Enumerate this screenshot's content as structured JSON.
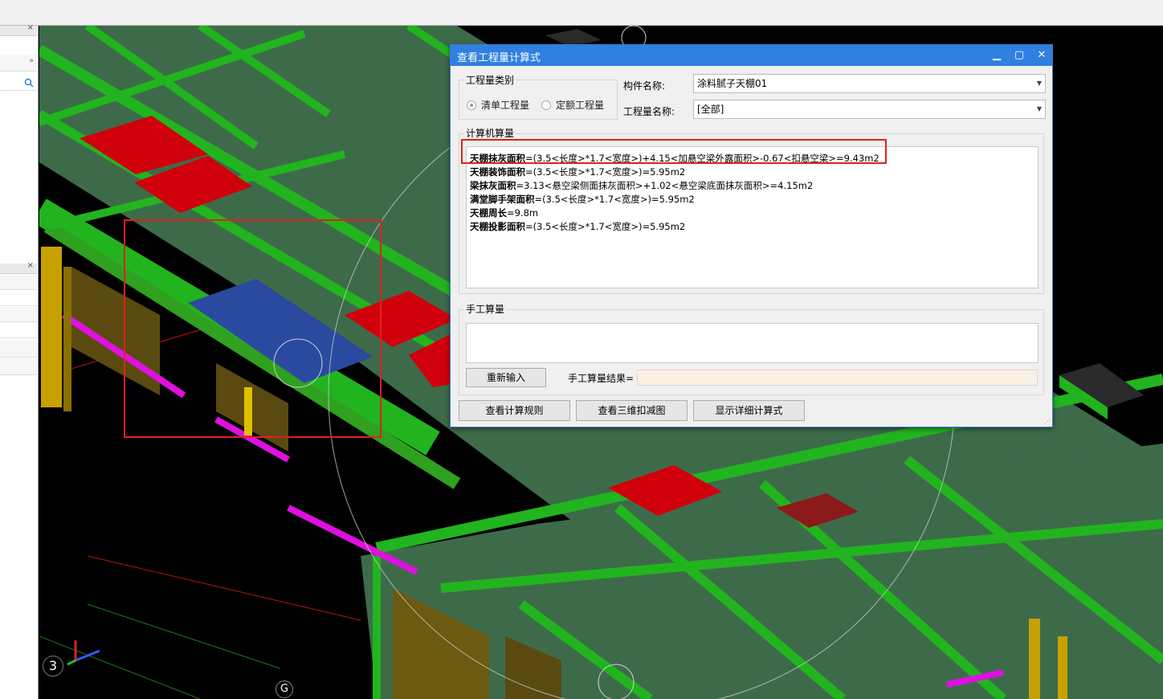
{
  "dialog": {
    "title": "查看工程量计算式",
    "minimize_icon": "minimize-icon",
    "maximize_icon": "maximize-icon",
    "close_icon": "close-icon",
    "category_group": {
      "title": "工程量类别",
      "options": [
        "清单工程量",
        "定额工程量"
      ],
      "selected": "清单工程量"
    },
    "component_label": "构件名称:",
    "component_value": "涂料腻子天棚01",
    "quantity_label": "工程量名称:",
    "quantity_value": "[全部]",
    "computer_group_title": "计算机算量",
    "calc_lines": [
      {
        "name": "天棚抹灰面积",
        "formula": "=(3.5<长度>*1.7<宽度>)+4.15<加悬空梁外露面积>-0.67<扣悬空梁>=9.43m2"
      },
      {
        "name": "天棚装饰面积",
        "formula": "=(3.5<长度>*1.7<宽度>)=5.95m2"
      },
      {
        "name": "梁抹灰面积",
        "formula": "=3.13<悬空梁侧面抹灰面积>+1.02<悬空梁底面抹灰面积>=4.15m2"
      },
      {
        "name": "满堂脚手架面积",
        "formula": "=(3.5<长度>*1.7<宽度>)=5.95m2"
      },
      {
        "name": "天棚周长",
        "formula": "=9.8m"
      },
      {
        "name": "天棚投影面积",
        "formula": "=(3.5<长度>*1.7<宽度>)=5.95m2"
      }
    ],
    "manual_group_title": "手工算量",
    "reenter_button": "重新输入",
    "manual_result_label": "手工算量结果=",
    "manual_result_value": "",
    "buttons": [
      "查看计算规则",
      "查看三维扣减图",
      "显示详细计算式"
    ]
  },
  "viewport": {
    "axis_number": "3",
    "grid_label": "G",
    "colors": {
      "background": "#000000",
      "slab": "#3d6b4a",
      "beam": "#22b41e",
      "red_slab": "#d0000c",
      "blue_slab": "#2a4aa0",
      "magenta": "#e010e0",
      "column": "#c8a000",
      "highlight_box": "#e0201c"
    }
  },
  "left_panel": {
    "search_icon": "search-icon",
    "expand_icon": "double-chevron-right-icon"
  }
}
